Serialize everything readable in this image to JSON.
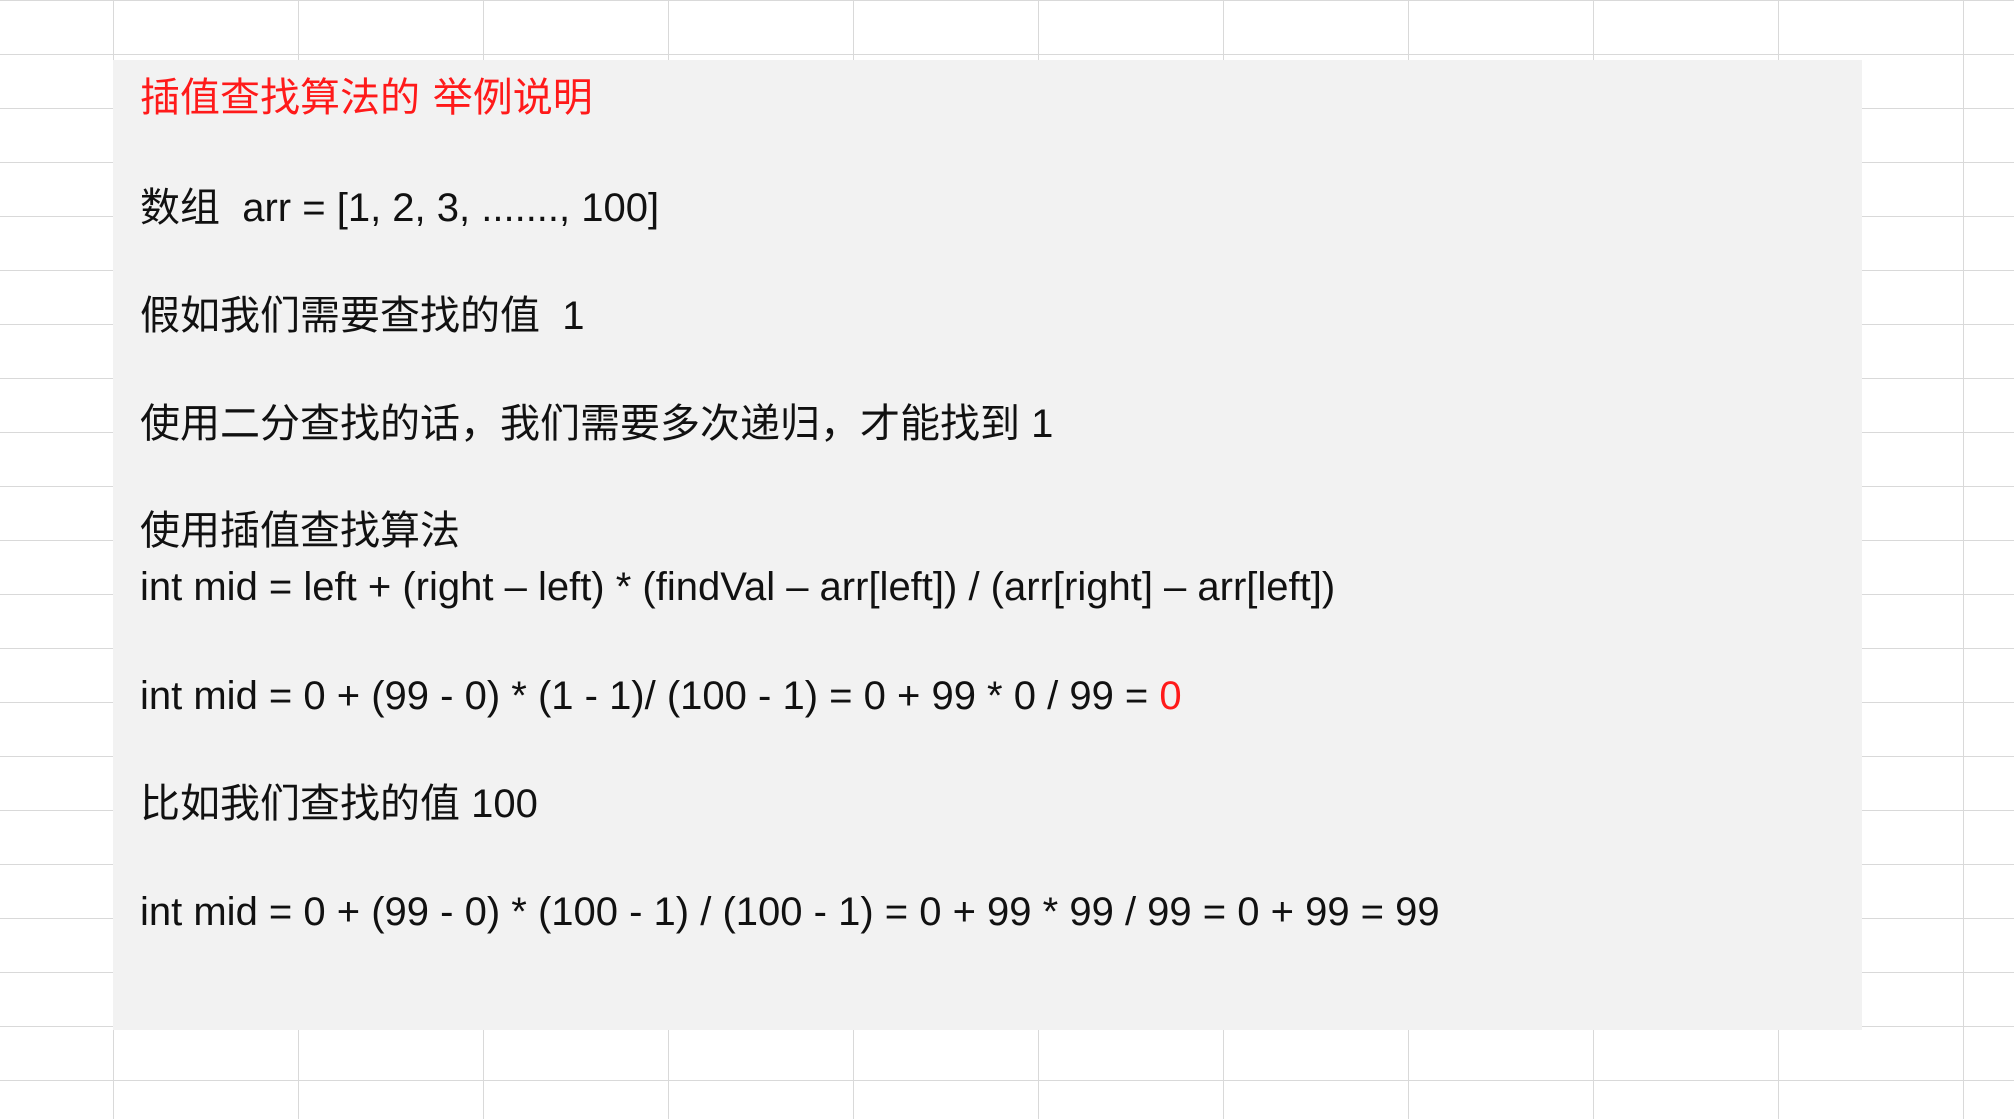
{
  "note": {
    "title": "插值查找算法的 举例说明",
    "array_line_label": "数组",
    "array_line_code": "arr = [1, 2, 3, ......., 100]",
    "assume_text": "假如我们需要查找的值",
    "assume_value": "1",
    "binary_search_text": "使用二分查找的话，我们需要多次递归，才能找到",
    "binary_search_value": "1",
    "interpolation_heading": "使用插值查找算法",
    "formula": "int mid = left + (right – left) * (findVal – arr[left]) / (arr[right] – arr[left])",
    "example1_prefix": "int mid = 0 + (99 - 0) * (1 - 1)/ (100 - 1) = 0 + 99 * 0 / 99 = ",
    "example1_result": "0",
    "compare_text": "比如我们查找的值",
    "compare_value": "100",
    "example2": "int mid = 0 + (99 - 0) * (100 - 1) / (100 - 1) = 0 + 99 * 99 / 99 = 0 + 99 = 99"
  },
  "colors": {
    "highlight": "#ff1a1a",
    "text": "#111111",
    "textbox_background": "#f2f2f2",
    "gridline": "#d9d9d9"
  }
}
